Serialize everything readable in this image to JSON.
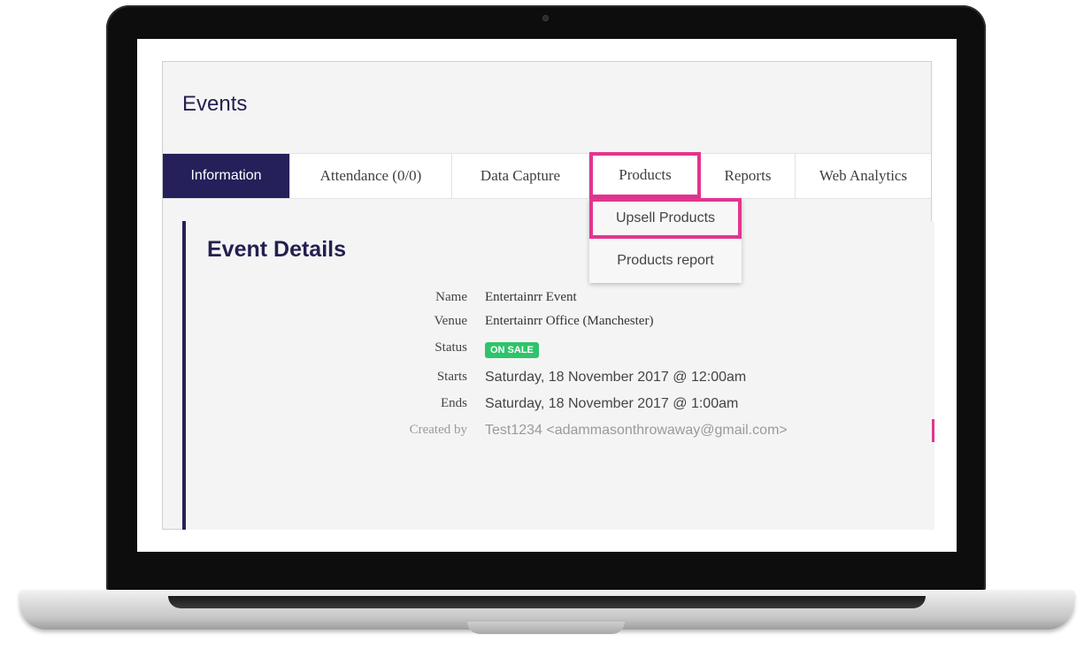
{
  "app": {
    "page_title": "Events"
  },
  "tabs": [
    {
      "label": "Information"
    },
    {
      "label": "Attendance (0/0)"
    },
    {
      "label": "Data Capture"
    },
    {
      "label": "Products"
    },
    {
      "label": "Reports"
    },
    {
      "label": "Web Analytics"
    }
  ],
  "products_menu": [
    {
      "label": "Upsell Products"
    },
    {
      "label": "Products report"
    }
  ],
  "event_details": {
    "title": "Event Details",
    "name_label": "Name",
    "name": "Entertainrr Event",
    "venue_label": "Venue",
    "venue": "Entertainrr Office (Manchester)",
    "status_label": "Status",
    "status": "ON SALE",
    "starts_label": "Starts",
    "starts": "Saturday, 18 November 2017 @ 12:00am",
    "ends_label": "Ends",
    "ends": "Saturday, 18 November 2017 @ 1:00am",
    "created_by_label": "Created by",
    "created_by": "Test1234 <adammasonthrowaway@gmail.com>"
  },
  "colors": {
    "accent": "#25205a",
    "highlight": "#e2358f",
    "status_green": "#2fc36b"
  }
}
